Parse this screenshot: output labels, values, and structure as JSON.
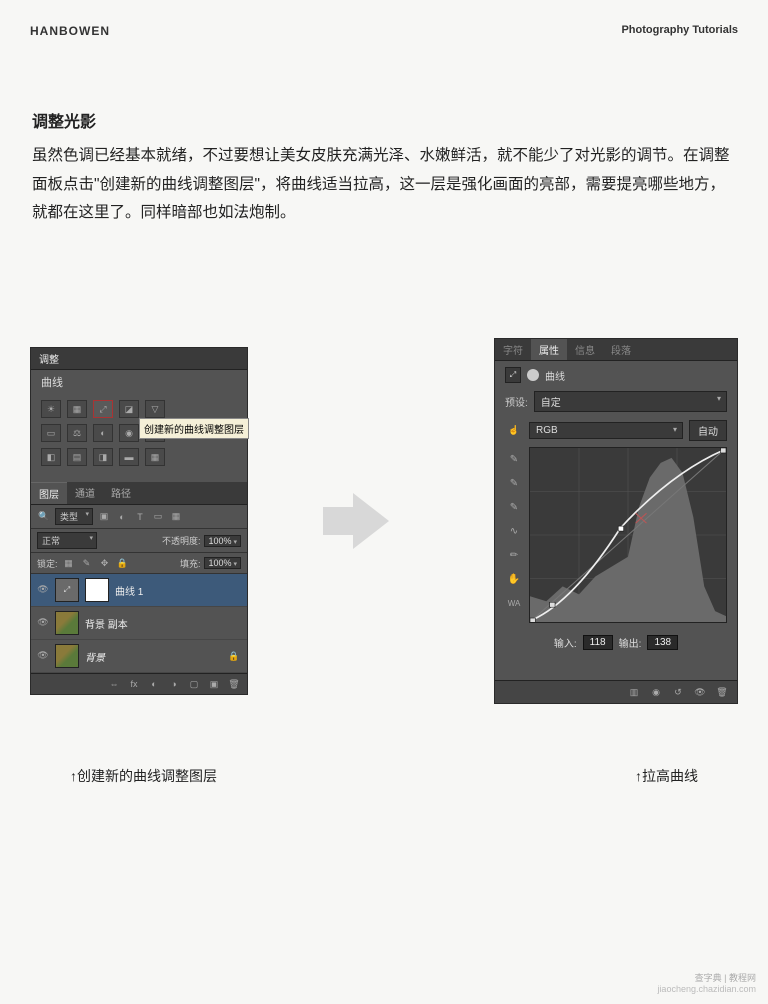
{
  "header": {
    "brand": "HANBOWEN",
    "subtitle": "Photography Tutorials"
  },
  "section": {
    "title": "调整光影",
    "body": "虽然色调已经基本就绪，不过要想让美女皮肤充满光泽、水嫩鲜活，就不能少了对光影的调节。在调整面板点击\"创建新的曲线调整图层\"，将曲线适当拉高，这一层是强化画面的亮部，需要提亮哪些地方，就都在这里了。同样暗部也如法炮制。"
  },
  "leftPanel": {
    "adjustments": {
      "header": "调整",
      "title": "曲线",
      "tooltip": "创建新的曲线调整图层"
    },
    "layersTabs": {
      "layers": "图层",
      "channels": "通道",
      "paths": "路径"
    },
    "filter": {
      "type": "类型"
    },
    "blend": {
      "mode": "正常",
      "opacityLabel": "不透明度:",
      "opacity": "100%"
    },
    "lock": {
      "label": "锁定:",
      "fillLabel": "填充:",
      "fill": "100%"
    },
    "layers": [
      {
        "name": "曲线 1"
      },
      {
        "name": "背景 副本"
      },
      {
        "name": "背景"
      }
    ]
  },
  "rightPanel": {
    "tabs": {
      "char": "字符",
      "props": "属性",
      "info": "信息",
      "para": "段落"
    },
    "curvesTitle": "曲线",
    "presetLabel": "预设:",
    "presetValue": "自定",
    "channel": "RGB",
    "autoLabel": "自动",
    "inputLabel": "输入:",
    "inputValue": "118",
    "outputLabel": "输出:",
    "outputValue": "138"
  },
  "captions": {
    "left": "↑创建新的曲线调整图层",
    "right": "↑拉高曲线"
  },
  "watermark": {
    "line1": "查字典 | 教程网",
    "line2": "jiaocheng.chazidian.com"
  },
  "chart_data": {
    "type": "line",
    "title": "曲线",
    "xlabel": "输入",
    "ylabel": "输出",
    "xlim": [
      0,
      255
    ],
    "ylim": [
      0,
      255
    ],
    "series": [
      {
        "name": "curve",
        "x": [
          0,
          30,
          118,
          255
        ],
        "y": [
          0,
          25,
          138,
          255
        ]
      },
      {
        "name": "baseline",
        "x": [
          0,
          255
        ],
        "y": [
          0,
          255
        ]
      }
    ],
    "marker": {
      "input": 118,
      "output": 138
    }
  }
}
